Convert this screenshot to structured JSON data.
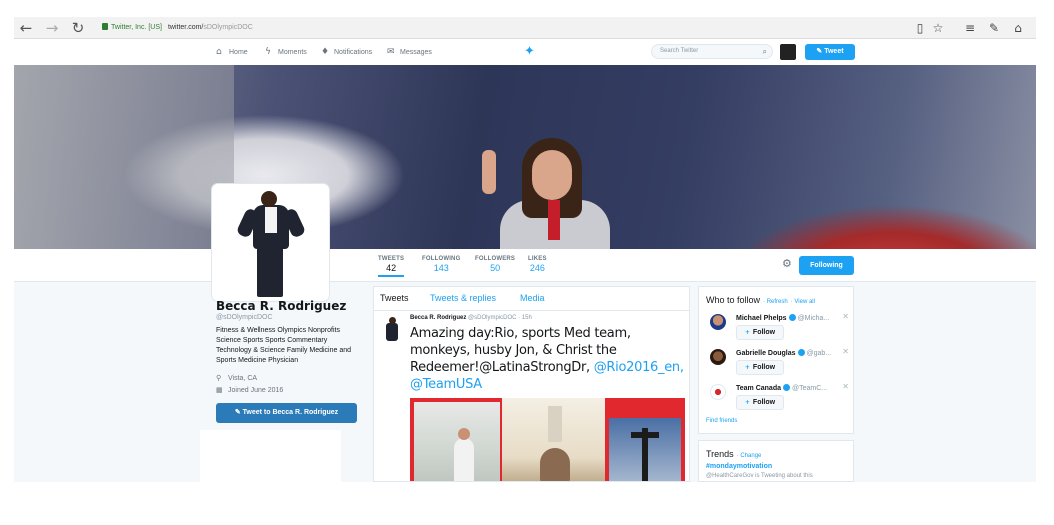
{
  "browser": {
    "secure_label": "Twitter, Inc. [US]",
    "url_host": "twitter.com/",
    "url_path": "sDOlympicDOC",
    "back": "←",
    "forward": "→",
    "refresh": "↻"
  },
  "nav": {
    "home": "Home",
    "moments": "Moments",
    "notifications": "Notifications",
    "messages": "Messages",
    "search_placeholder": "Search Twitter",
    "tweet_button": "Tweet"
  },
  "stats": [
    {
      "label": "TWEETS",
      "value": "42"
    },
    {
      "label": "FOLLOWING",
      "value": "143"
    },
    {
      "label": "FOLLOWERS",
      "value": "50"
    },
    {
      "label": "LIKES",
      "value": "246"
    }
  ],
  "follow_button": "Following",
  "profile": {
    "name": "Becca R. Rodriguez",
    "handle": "@sDOlympicDOC",
    "bio": "Fitness & Wellness Olympics Nonprofits Science Sports Sports Commentary Technology & Science Family Medicine and Sports Medicine Physician",
    "location": "Vista, CA",
    "joined": "Joined June 2016",
    "tweet_to": "Tweet to Becca R. Rodriguez"
  },
  "timeline": {
    "tabs": [
      "Tweets",
      "Tweets & replies",
      "Media"
    ],
    "tweet": {
      "name": "Becca R. Rodriguez",
      "handle": "@sDOlympicDOC",
      "time": "15h",
      "text": "Amazing day:Rio, sports Med team, monkeys, husby Jon, & Christ the Redeemer!@LatinaStrongDr,",
      "mentions": "@Rio2016_en, @TeamUSA"
    }
  },
  "who_to_follow": {
    "title": "Who to follow",
    "refresh": "· Refresh",
    "view_all": "· View all",
    "follow_label": "Follow",
    "suggestions": [
      {
        "name": "Michael Phelps",
        "handle": "@Micha..."
      },
      {
        "name": "Gabrielle Douglas",
        "handle": "@gab..."
      },
      {
        "name": "Team Canada",
        "handle": "@TeamC..."
      }
    ],
    "find_friends": "Find friends"
  },
  "trends": {
    "title": "Trends",
    "change": "· Change",
    "items": [
      {
        "tag": "#mondaymotivation",
        "sub": "@HealthCareGov is Tweeting about this"
      }
    ]
  },
  "colors": {
    "accent": "#1da1f2",
    "tweet_to_button": "#2b7bb9"
  }
}
